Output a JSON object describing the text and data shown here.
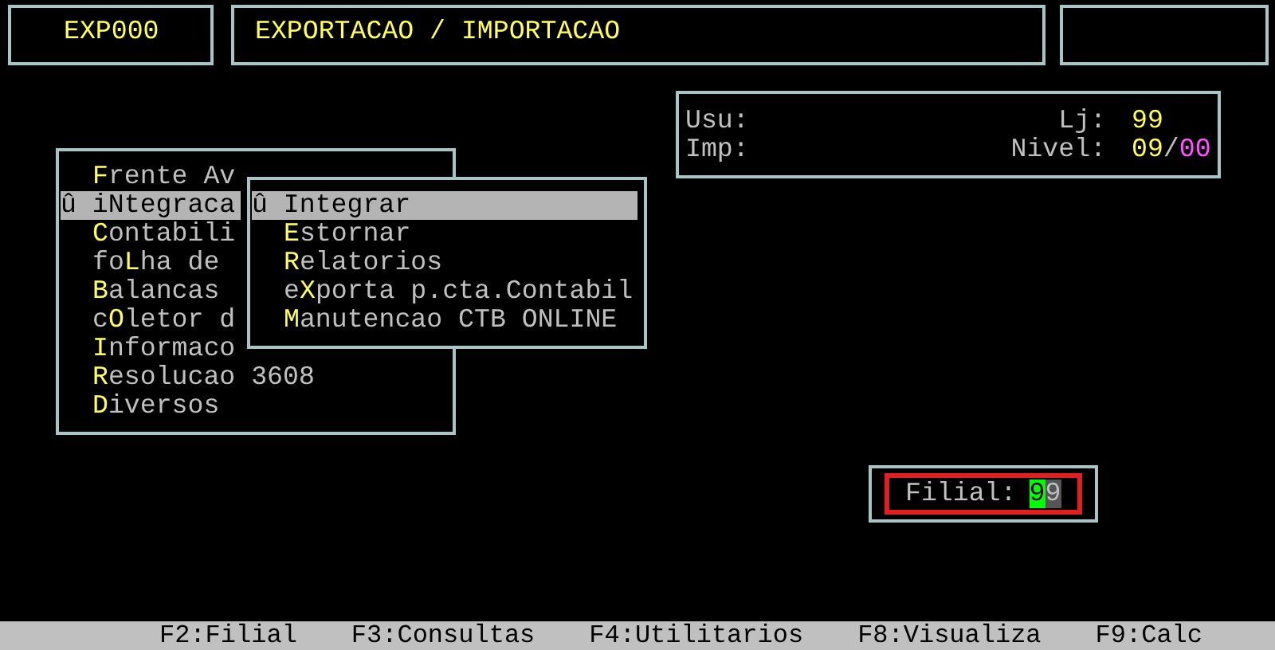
{
  "header": {
    "program_code": "EXP000",
    "title": "EXPORTACAO / IMPORTACAO"
  },
  "info": {
    "usu_label": "Usu:",
    "imp_label": "Imp:",
    "lj_label": "Lj:",
    "lj_value": "99",
    "nivel_label": "Nivel:",
    "nivel_parts": [
      {
        "text": "09",
        "color": "#ffff55"
      },
      {
        "text": "/",
        "color": "#c0c0c0"
      },
      {
        "text": "00",
        "color": "#ff55ff"
      }
    ]
  },
  "main_menu": [
    {
      "hot": "F",
      "after": "rente Av",
      "selected": false
    },
    {
      "marker": "û",
      "before": "i",
      "hot": "N",
      "after": "tegraca",
      "selected": true
    },
    {
      "hot": "C",
      "after": "ontabili",
      "selected": false
    },
    {
      "before": "fo",
      "hot": "L",
      "after": "ha de",
      "selected": false
    },
    {
      "hot": "B",
      "after": "alancas",
      "selected": false
    },
    {
      "before": "c",
      "hot": "O",
      "after": "letor d",
      "selected": false
    },
    {
      "hot": "I",
      "after": "nformaco",
      "selected": false
    },
    {
      "hot": "R",
      "after": "esolucao 3608",
      "selected": false
    },
    {
      "hot": "D",
      "after": "iversos",
      "selected": false
    }
  ],
  "submenu": [
    {
      "marker": "û",
      "hot": "I",
      "after": "ntegrar",
      "selected": true
    },
    {
      "hot": "E",
      "after": "stornar",
      "selected": false
    },
    {
      "hot": "R",
      "after": "elatorios",
      "selected": false
    },
    {
      "before": "e",
      "hot": "X",
      "after": "porta p.cta.Contabil",
      "selected": false
    },
    {
      "hot": "M",
      "after": "anutencao CTB ONLINE",
      "selected": false
    }
  ],
  "filial": {
    "label": "Filial:",
    "value_chars": [
      {
        "char": "9",
        "selected": true
      },
      {
        "char": "9",
        "selected": false
      }
    ]
  },
  "function_keys": [
    "F2:Filial",
    "F3:Consultas",
    "F4:Utilitarios",
    "F8:Visualiza",
    "F9:Calc"
  ]
}
